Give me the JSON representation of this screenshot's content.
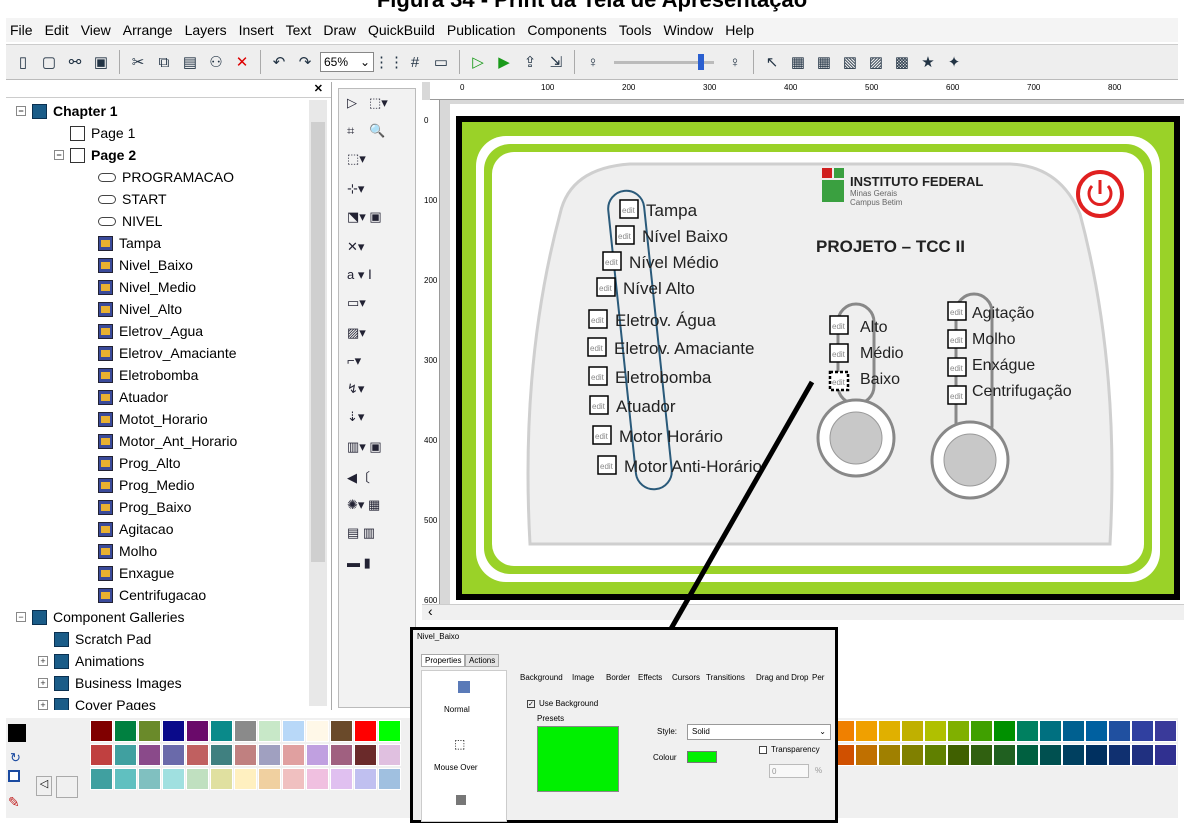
{
  "caption": "Figura 34 - Print da Tela de Apresentação",
  "menu": [
    "File",
    "Edit",
    "View",
    "Arrange",
    "Layers",
    "Insert",
    "Text",
    "Draw",
    "QuickBuild",
    "Publication",
    "Components",
    "Tools",
    "Window",
    "Help"
  ],
  "toolbar": {
    "zoom": "65%"
  },
  "tree": {
    "chapter": "Chapter 1",
    "page1": "Page 1",
    "page2": "Page 2",
    "items": [
      "PROGRAMACAO",
      "START",
      "NIVEL",
      "Tampa",
      "Nivel_Baixo",
      "Nivel_Medio",
      "Nivel_Alto",
      "Eletrov_Agua",
      "Eletrov_Amaciante",
      "Eletrobomba",
      "Atuador",
      "Motot_Horario",
      "Motor_Ant_Horario",
      "Prog_Alto",
      "Prog_Medio",
      "Prog_Baixo",
      "Agitacao",
      "Molho",
      "Enxague",
      "Centrifugacao"
    ],
    "galleries": "Component Galleries",
    "scratch": "Scratch Pad",
    "anim": "Animations",
    "business": "Business Images",
    "cover": "Cover Pages"
  },
  "ruler": {
    "top": [
      "0",
      "100",
      "200",
      "300",
      "400",
      "500",
      "600",
      "700",
      "800"
    ],
    "left": [
      "0",
      "100",
      "200",
      "300",
      "400",
      "500",
      "600"
    ]
  },
  "panel": {
    "logo_main": "INSTITUTO FEDERAL",
    "logo_sub1": "Minas Gerais",
    "logo_sub2": "Campus Betim",
    "project": "PROJETO – TCC II",
    "left_labels": [
      "Tampa",
      "Nível Baixo",
      "Nível Médio",
      "Nível Alto",
      "Eletrov. Água",
      "Eletrov. Amaciante",
      "Eletrobomba",
      "Atuador",
      "Motor Horário",
      "Motor Anti-Horário"
    ],
    "mid_labels": [
      "Alto",
      "Médio",
      "Baixo"
    ],
    "right_labels": [
      "Agitação",
      "Molho",
      "Enxágue",
      "Centrifugação"
    ],
    "edit": "edit"
  },
  "props": {
    "title": "Nivel_Baixo",
    "tab_props": "Properties",
    "tab_actions": "Actions",
    "tabs": [
      "Background",
      "Image",
      "Border",
      "Effects",
      "Cursors",
      "Transitions",
      "Drag and Drop",
      "Per"
    ],
    "states": [
      "Normal",
      "Mouse Over"
    ],
    "use_bg": "Use Background",
    "presets": "Presets",
    "style_label": "Style:",
    "style_value": "Solid",
    "colour_label": "Colour",
    "transparency": "Transparency",
    "trans_value": "0",
    "pct": "%"
  }
}
